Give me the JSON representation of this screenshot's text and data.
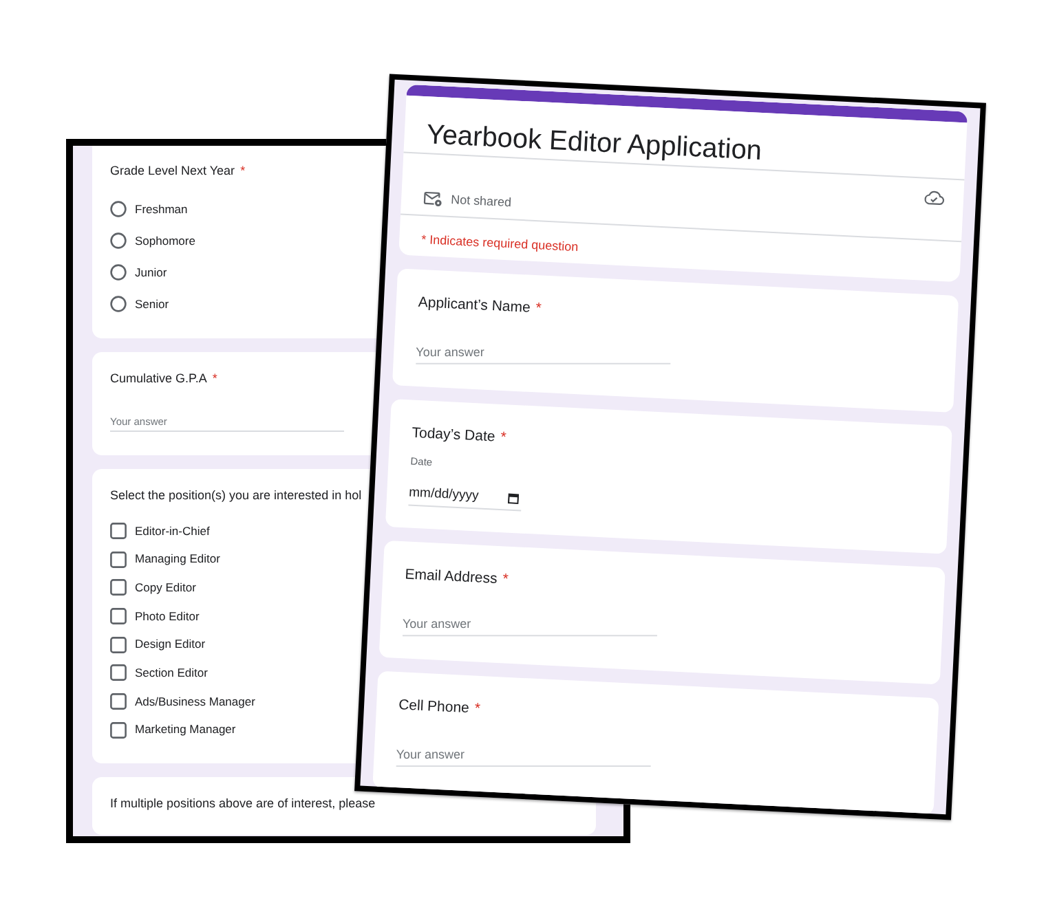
{
  "back_sheet": {
    "questions": [
      {
        "kind": "multiple_choice",
        "label": "Grade Level Next Year",
        "mark": "*",
        "options": [
          {
            "label": "Freshman",
            "selected": false
          },
          {
            "label": "Sophomore",
            "selected": false
          },
          {
            "label": "Junior",
            "selected": false
          },
          {
            "label": "Senior",
            "selected": false
          }
        ]
      },
      {
        "kind": "short_answer",
        "label": "Cumulative G.P.A",
        "mark": "*",
        "placeholder": "Your answer"
      },
      {
        "kind": "checkboxes",
        "label": "Select the position(s) you are interested in hol",
        "options": [
          {
            "label": "Editor-in-Chief",
            "checked": false
          },
          {
            "label": "Managing Editor",
            "checked": false
          },
          {
            "label": "Copy Editor",
            "checked": false
          },
          {
            "label": "Photo Editor",
            "checked": false
          },
          {
            "label": "Design Editor",
            "checked": false
          },
          {
            "label": "Section Editor",
            "checked": false
          },
          {
            "label": "Ads/Business Manager",
            "checked": false
          },
          {
            "label": "Marketing Manager",
            "checked": false
          }
        ]
      },
      {
        "kind": "label_only",
        "label": "If multiple positions above are of interest, please"
      }
    ]
  },
  "front_sheet": {
    "title": "Yearbook Editor Application",
    "sharing": "Not shared",
    "required_note": "* Indicates required question",
    "questions": [
      {
        "kind": "short_answer",
        "label": "Applicant’s Name",
        "mark": "*",
        "placeholder": "Your answer"
      },
      {
        "kind": "date",
        "label": "Today’s Date",
        "mark": "*",
        "sublabel": "Date",
        "placeholder": "mm/dd/yyyy"
      },
      {
        "kind": "short_answer",
        "label": "Email Address",
        "mark": "*",
        "placeholder": "Your answer"
      },
      {
        "kind": "short_answer",
        "label": "Cell Phone",
        "mark": "*",
        "placeholder": "Your answer"
      }
    ]
  }
}
